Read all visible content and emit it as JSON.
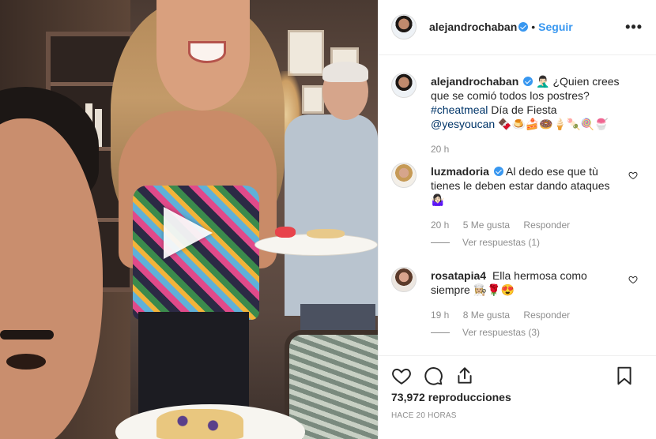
{
  "post": {
    "author": "alejandrochaban",
    "follow_label": "Seguir",
    "separator": "•",
    "more_label": "•••"
  },
  "caption": {
    "username": "alejandrochaban",
    "emoji_prefix": "🤦🏻‍♂️",
    "text_1": "¿Quien crees que se comió todos los postres?",
    "hashtag": "#cheatmeal",
    "text_2": "Día de Fiesta",
    "mention": "@yesyoucan",
    "emoji_suffix": "🍫🍮🍰🍩🍦🍡🍭🍧",
    "time": "20 h"
  },
  "comments": [
    {
      "username": "luzmadoria",
      "text": "Al dedo ese que tù tienes le deben estar dando ataques🤷🏻‍♀️",
      "time": "20 h",
      "likes": "5 Me gusta",
      "reply": "Responder",
      "view_replies": "Ver respuestas (1)"
    },
    {
      "username": "rosatapia4",
      "text": "Ella hermosa como siempre 👩🏼‍🍳🌹😍",
      "time": "19 h",
      "likes": "8 Me gusta",
      "reply": "Responder",
      "view_replies": "Ver respuestas (3)"
    }
  ],
  "stats": {
    "views_count": "73,972",
    "views_label": "reproducciones",
    "time_ago": "HACE 20 HORAS"
  },
  "icons": {
    "like": "heart-icon",
    "comment": "comment-icon",
    "share": "share-icon",
    "save": "bookmark-icon",
    "play": "play-icon",
    "verified": "verified-icon",
    "more": "more-options-icon"
  },
  "colors": {
    "link_blue": "#3897f0",
    "text": "#262626",
    "muted": "#8e8e8e",
    "hashtag": "#003569"
  }
}
